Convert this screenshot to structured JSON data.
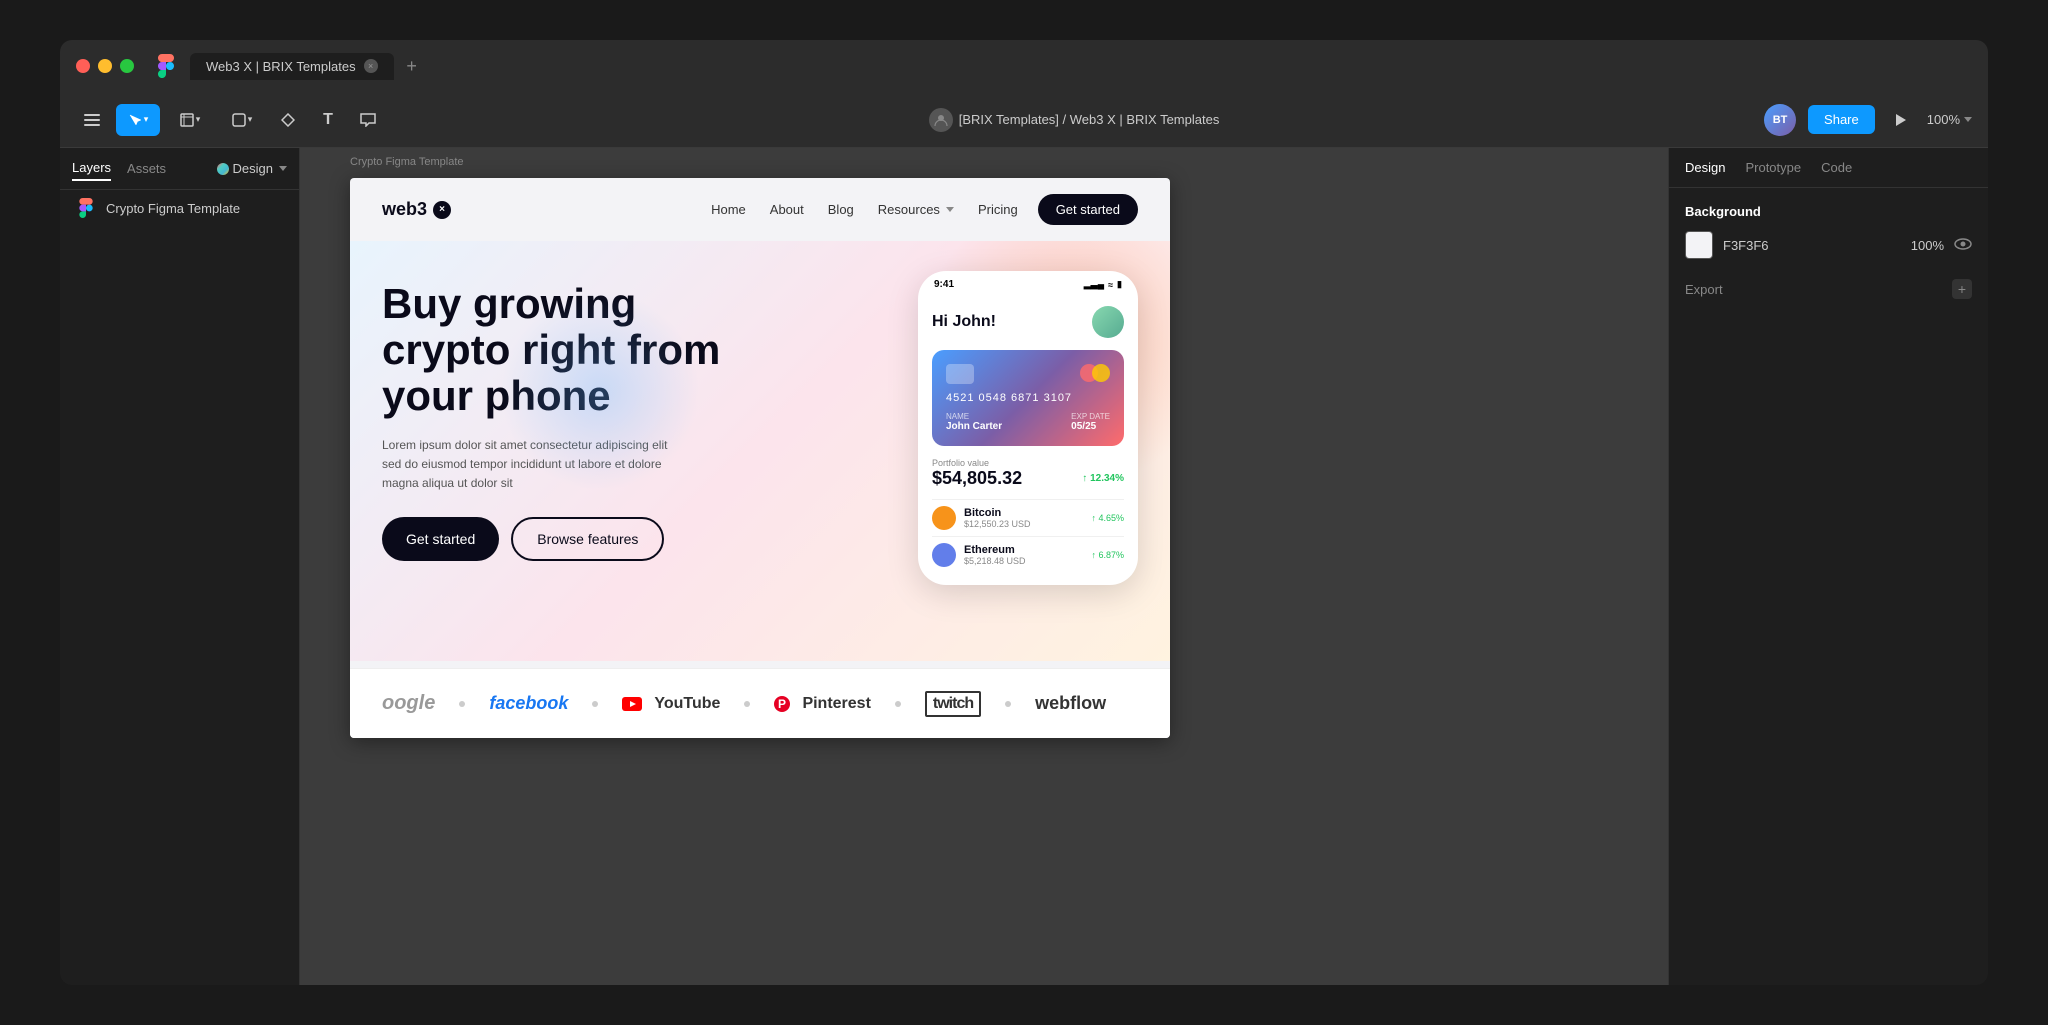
{
  "window": {
    "title": "Web3 X | BRIX Templates",
    "tab_label": "Web3 X | BRIX Templates"
  },
  "toolbar": {
    "zoom": "100%",
    "breadcrumb": "[BRIX Templates] / Web3 X | BRIX Templates",
    "share_label": "Share"
  },
  "left_panel": {
    "tabs": [
      "Layers",
      "Assets"
    ],
    "design_label": "Design",
    "layer_item": "Crypto Figma Template"
  },
  "right_panel": {
    "tabs": [
      "Design",
      "Prototype",
      "Code"
    ],
    "background_section": "Background",
    "color_value": "F3F3F6",
    "opacity_value": "100%",
    "export_label": "Export"
  },
  "template": {
    "logo": "web3",
    "nav_links": [
      "Home",
      "About",
      "Blog",
      "Resources",
      "Pricing"
    ],
    "get_started": "Get started",
    "hero_title_line1": "Buy growing",
    "hero_title_line2": "crypto right from",
    "hero_title_line3": "your phone",
    "hero_subtitle": "Lorem ipsum dolor sit amet consectetur adipiscing elit sed do eiusmod tempor incididunt ut labore et dolore magna aliqua ut dolor sit",
    "btn_primary": "Get started",
    "btn_secondary": "Browse features",
    "phone": {
      "time": "9:41",
      "greeting": "Hi John!",
      "card_number": "4521 0548 6871 3107",
      "card_holder": "John Carter",
      "card_expiry": "05/25",
      "card_holder_label": "NAME",
      "card_expiry_label": "EXP DATE",
      "portfolio_label": "Portfolio value",
      "portfolio_value": "$54,805.32",
      "portfolio_change": "↑ 12.34%",
      "bitcoin_name": "Bitcoin",
      "bitcoin_price": "$12,550.23 USD",
      "bitcoin_change": "↑ 4.65%",
      "ethereum_name": "Ethereum",
      "ethereum_price": "$5,218.48 USD",
      "ethereum_change": "↑ 6.87%"
    },
    "brands": [
      "oogle",
      "facebook",
      "YouTube",
      "Pinterest",
      "twitch",
      "webflow"
    ]
  }
}
